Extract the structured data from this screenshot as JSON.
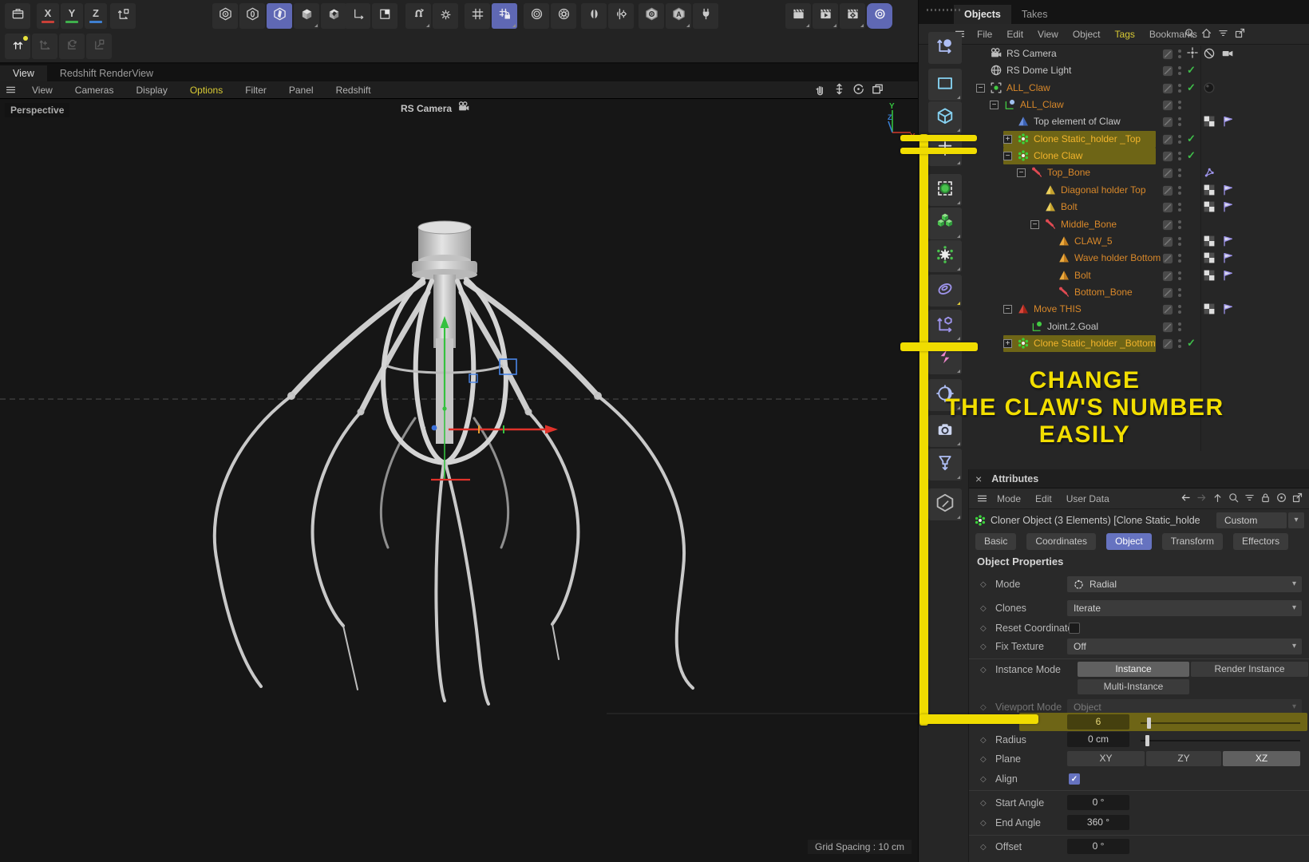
{
  "colors": {
    "accent": "#6673c0",
    "annotation_yellow": "#f0dc00",
    "row_highlight": "#6e6516",
    "orange_text": "#d8882a",
    "green_check": "#3fbf4a"
  },
  "top_toolbar": {
    "left_icons": [
      "content-box"
    ],
    "axis_buttons": [
      "X",
      "Y",
      "Z"
    ],
    "axis_colors": [
      "#c84038",
      "#3faf4c",
      "#3f7fd0"
    ],
    "coord_icon": "coordinate-system",
    "transform_icons": [
      "make-editable",
      "move-disabled",
      "rotate-disabled",
      "scale-disabled"
    ],
    "primitive_icons": [
      "hex-sphere",
      "hex-ring",
      "hex-plane",
      "hex-cube",
      "hex-fracture"
    ],
    "corner_icons": [
      "corner-axis",
      "corner-square"
    ],
    "snap_icons": [
      "magnet-snap",
      "snap-settings"
    ],
    "grid_icons": [
      "grid",
      "grid-lock"
    ],
    "circle_icons": [
      "rings",
      "ring-gear"
    ],
    "mirror_icons": [
      "mirror",
      "mirror-settings"
    ],
    "material_icons": [
      "hex-eye",
      "hex-material",
      "plug"
    ],
    "render_icons": [
      "render-view",
      "render-queue",
      "render-settings"
    ],
    "redshift_icon": "redshift-view"
  },
  "view_tabs": {
    "active": "View",
    "inactive": "Redshift RenderView"
  },
  "viewport": {
    "menu": [
      "View",
      "Cameras",
      "Display",
      "Options",
      "Filter",
      "Panel",
      "Redshift"
    ],
    "highlighted_menu": "Options",
    "nav_icons": [
      "pan-hand",
      "dolly",
      "orbit",
      "maximize"
    ],
    "view_label": "Perspective",
    "camera_label": "RS Camera",
    "grid_spacing": "Grid Spacing : 10 cm",
    "axis": {
      "x": "X",
      "y": "Y",
      "z": "Z"
    }
  },
  "side_toolbar": [
    "live-selection",
    "rect-selection",
    "model-mode",
    "axis-mode",
    "points-mode",
    "polygons-mode",
    "snap-gear",
    "ring-select",
    "coordinates-mode",
    "symmetry-mode",
    "shading-mode",
    "viewport-camera",
    "filter-funnel",
    "edit-mode"
  ],
  "objects_panel": {
    "tabs": [
      "Objects",
      "Takes"
    ],
    "active_tab": "Objects",
    "menu": [
      "File",
      "Edit",
      "View",
      "Object",
      "Tags",
      "Bookmarks"
    ],
    "highlighted_menu": "Tags",
    "header_icons": [
      "search",
      "home",
      "filter",
      "popout"
    ],
    "tree": [
      {
        "label": "RS Camera",
        "icon": "camera",
        "depth": 0,
        "color": "white",
        "state": "target",
        "tags": [
          "prohibit",
          "camera-tag"
        ]
      },
      {
        "label": "RS Dome Light",
        "icon": "globe",
        "depth": 0,
        "color": "white",
        "state": "check",
        "tags": []
      },
      {
        "label": "ALL_Claw",
        "icon": "instance",
        "depth": 0,
        "color": "orange",
        "expand": "minus",
        "state": "check",
        "tags": [
          "sphere"
        ]
      },
      {
        "label": "ALL_Claw",
        "icon": "null",
        "depth": 1,
        "color": "orange",
        "expand": "minus",
        "tags": []
      },
      {
        "label": "Top element of Claw",
        "icon": "pyramid-blue",
        "depth": 2,
        "color": "white",
        "tags": [
          "checker",
          "flag"
        ]
      },
      {
        "label": "Clone Static_holder _Top",
        "icon": "cloner",
        "depth": 2,
        "color": "orange",
        "expand": "plus",
        "state": "check",
        "highlighted": true,
        "tags": []
      },
      {
        "label": "Clone Claw",
        "icon": "cloner",
        "depth": 2,
        "color": "orange",
        "expand": "minus",
        "state": "check",
        "highlighted": true,
        "tags": []
      },
      {
        "label": "Top_Bone",
        "icon": "bone",
        "depth": 3,
        "color": "orange",
        "expand": "minus",
        "tags": [
          "ik"
        ]
      },
      {
        "label": "Diagonal  holder Top",
        "icon": "pyramid-yellow",
        "depth": 4,
        "color": "orange",
        "tags": [
          "checker",
          "flag"
        ]
      },
      {
        "label": "Bolt",
        "icon": "pyramid-yellow",
        "depth": 4,
        "color": "orange",
        "tags": [
          "checker",
          "flag"
        ]
      },
      {
        "label": "Middle_Bone",
        "icon": "bone",
        "depth": 4,
        "color": "orange",
        "expand": "minus",
        "tags": []
      },
      {
        "label": "CLAW_5",
        "icon": "pyramid-orange",
        "depth": 5,
        "color": "orange",
        "tags": [
          "checker",
          "flag"
        ]
      },
      {
        "label": "Wave holder Bottom",
        "icon": "pyramid-orange",
        "depth": 5,
        "color": "orange",
        "tags": [
          "checker",
          "flag"
        ]
      },
      {
        "label": "Bolt",
        "icon": "pyramid-orange",
        "depth": 5,
        "color": "orange",
        "tags": [
          "checker",
          "flag"
        ]
      },
      {
        "label": "Bottom_Bone",
        "icon": "bone",
        "depth": 5,
        "color": "orange",
        "tags": []
      },
      {
        "label": "Move THIS",
        "icon": "pyramid-red",
        "depth": 2,
        "color": "orange",
        "expand": "minus",
        "tags": [
          "checker",
          "flag"
        ]
      },
      {
        "label": "Joint.2.Goal",
        "icon": "joint",
        "depth": 3,
        "color": "white",
        "tags": []
      },
      {
        "label": "Clone Static_holder _Bottom",
        "icon": "cloner",
        "depth": 2,
        "color": "orange",
        "expand": "plus",
        "state": "check",
        "highlighted": true,
        "tags": []
      }
    ]
  },
  "annotation": {
    "lines": [
      "CHANGE",
      "THE CLAW'S NUMBER",
      "EASILY"
    ]
  },
  "attributes": {
    "title": "Attributes",
    "close_glyph": "×",
    "menu": [
      "Mode",
      "Edit",
      "User Data"
    ],
    "header_icons": [
      "back",
      "forward",
      "up",
      "search",
      "filter",
      "lock",
      "record",
      "popout"
    ],
    "object_title": "Cloner Object (3 Elements) [Clone Static_holder ...",
    "preset_value": "Custom",
    "tabs": [
      "Basic",
      "Coordinates",
      "Object",
      "Transform",
      "Effectors"
    ],
    "active_tab": "Object",
    "section_title": "Object Properties",
    "fields": {
      "mode": {
        "label": "Mode",
        "value": "Radial"
      },
      "clones": {
        "label": "Clones",
        "value": "Iterate"
      },
      "reset_coordinates": {
        "label": "Reset Coordinates",
        "checked": false
      },
      "fix_texture": {
        "label": "Fix Texture",
        "value": "Off"
      },
      "instance_mode": {
        "label": "Instance Mode",
        "selected": "Instance",
        "option2": "Render Instance",
        "option3": "Multi-Instance"
      },
      "viewport_mode": {
        "label": "Viewport Mode",
        "value": "Object",
        "disabled": true
      },
      "count": {
        "label": "",
        "value": "6",
        "highlighted": true
      },
      "radius": {
        "label": "Radius",
        "value": "0 cm"
      },
      "plane": {
        "label": "Plane",
        "options": [
          "XY",
          "ZY",
          "XZ"
        ],
        "selected": "XZ"
      },
      "align": {
        "label": "Align",
        "checked": true
      },
      "start_angle": {
        "label": "Start Angle",
        "value": "0 °"
      },
      "end_angle": {
        "label": "End Angle",
        "value": "360 °"
      },
      "offset": {
        "label": "Offset",
        "value": "0 °"
      }
    }
  }
}
